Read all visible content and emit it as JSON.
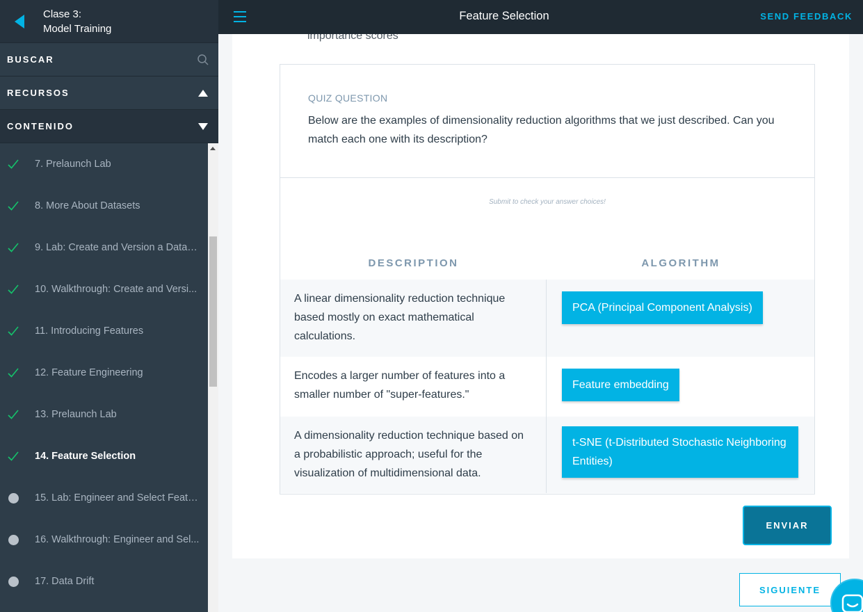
{
  "sidebar": {
    "lesson_line1": "Clase 3:",
    "lesson_line2": "Model Training",
    "search_label": "BUSCAR",
    "resources_label": "RECURSOS",
    "contents_label": "CONTENIDO",
    "items": [
      {
        "label": "7. Prelaunch Lab",
        "status": "complete"
      },
      {
        "label": "8. More About Datasets",
        "status": "complete"
      },
      {
        "label": "9. Lab: Create and Version a Datas...",
        "status": "complete"
      },
      {
        "label": "10. Walkthrough: Create and Versi...",
        "status": "complete"
      },
      {
        "label": "11. Introducing Features",
        "status": "complete"
      },
      {
        "label": "12. Feature Engineering",
        "status": "complete"
      },
      {
        "label": "13. Prelaunch Lab",
        "status": "complete"
      },
      {
        "label": "14. Feature Selection",
        "status": "complete-active"
      },
      {
        "label": "15. Lab: Engineer and Select Featu...",
        "status": "incomplete"
      },
      {
        "label": "16. Walkthrough: Engineer and Sel...",
        "status": "incomplete"
      },
      {
        "label": "17. Data Drift",
        "status": "incomplete"
      }
    ]
  },
  "header": {
    "title": "Feature Selection",
    "feedback_label": "SEND FEEDBACK"
  },
  "main": {
    "cut_text": "importance scores",
    "quiz": {
      "label": "QUIZ QUESTION",
      "question": "Below are the examples of dimensionality reduction algorithms that we just described. Can you match each one with its description?",
      "hint": "Submit to check your answer choices!",
      "col_description": "DESCRIPTION",
      "col_algorithm": "ALGORITHM",
      "rows": [
        {
          "description": "A linear dimensionality reduction technique based mostly on exact mathematical calculations.",
          "algorithm": "PCA (Principal Component Analysis)"
        },
        {
          "description": "Encodes a larger number of features into a smaller number of \"super-features.\"",
          "algorithm": "Feature embedding"
        },
        {
          "description": "A dimensionality reduction technique based on a probabilistic approach; useful for the visualization of multidimensional data.",
          "algorithm": "t-SNE (t-Distributed Stochastic Neighboring Entities)"
        }
      ],
      "submit_label": "ENVIAR"
    },
    "next_label": "SIGUIENTE"
  },
  "colors": {
    "accent": "#02b3e4",
    "sidebar_bg": "#2e3d49",
    "topbar_bg": "#1f2a33",
    "check": "#15c26b"
  }
}
